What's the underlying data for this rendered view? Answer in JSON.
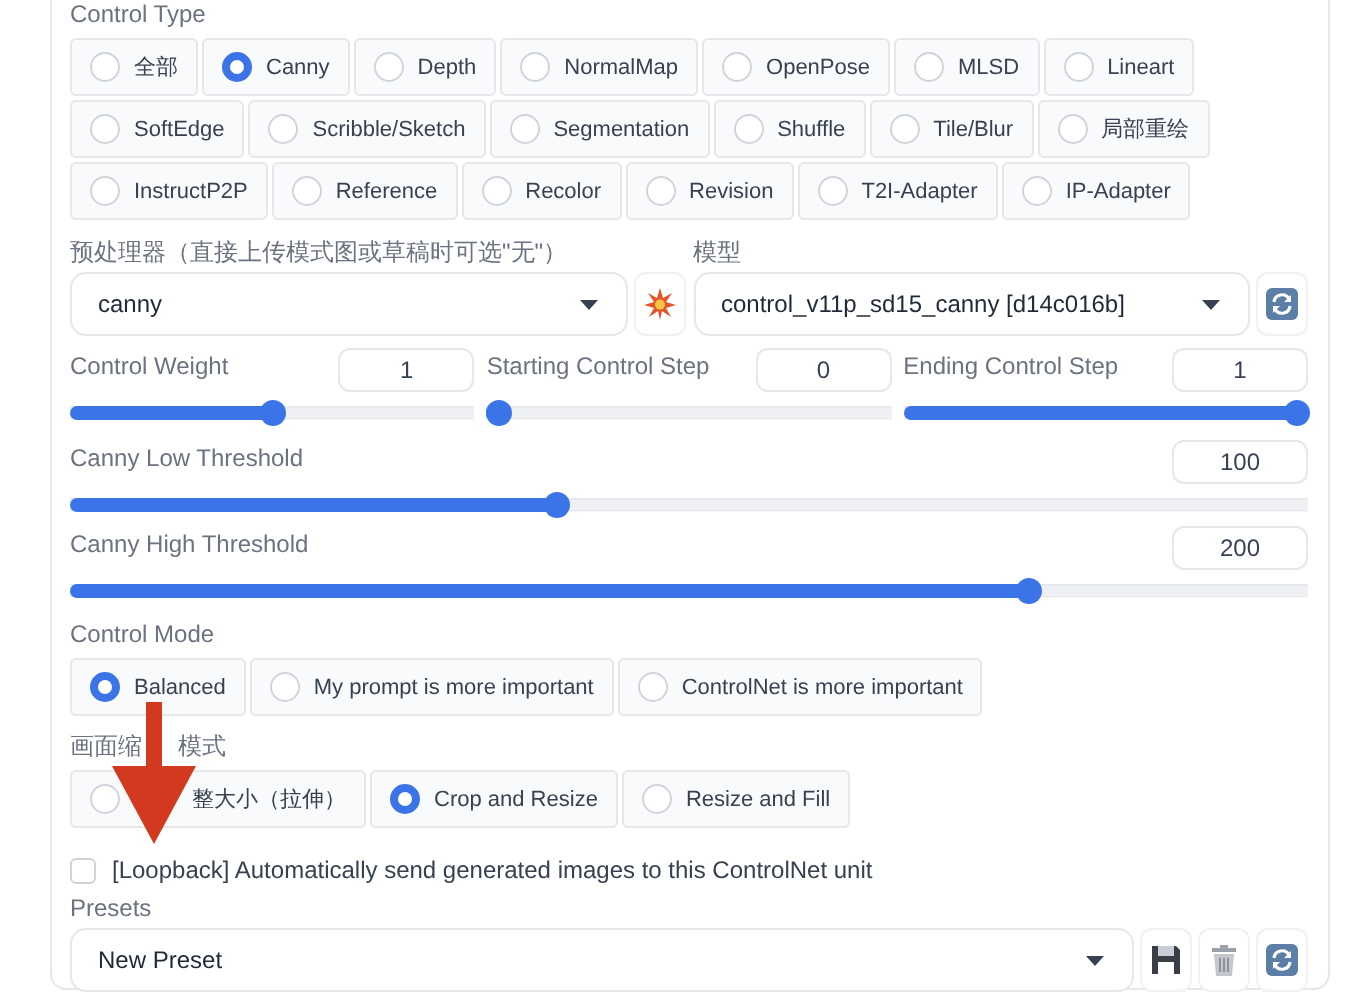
{
  "control_type": {
    "label": "Control Type",
    "rows": [
      {
        "options": [
          {
            "label": "全部",
            "selected": false
          },
          {
            "label": "Canny",
            "selected": true
          },
          {
            "label": "Depth",
            "selected": false
          },
          {
            "label": "NormalMap",
            "selected": false
          },
          {
            "label": "OpenPose",
            "selected": false
          },
          {
            "label": "MLSD",
            "selected": false
          },
          {
            "label": "Lineart",
            "selected": false
          }
        ]
      },
      {
        "options": [
          {
            "label": "SoftEdge",
            "selected": false
          },
          {
            "label": "Scribble/Sketch",
            "selected": false
          },
          {
            "label": "Segmentation",
            "selected": false
          },
          {
            "label": "Shuffle",
            "selected": false
          },
          {
            "label": "Tile/Blur",
            "selected": false
          },
          {
            "label": "局部重绘",
            "selected": false
          }
        ]
      },
      {
        "options": [
          {
            "label": "InstructP2P",
            "selected": false
          },
          {
            "label": "Reference",
            "selected": false
          },
          {
            "label": "Recolor",
            "selected": false
          },
          {
            "label": "Revision",
            "selected": false
          },
          {
            "label": "T2I-Adapter",
            "selected": false
          },
          {
            "label": "IP-Adapter",
            "selected": false
          }
        ]
      }
    ]
  },
  "preprocessor": {
    "label": "预处理器（直接上传模式图或草稿时可选\"无\"）",
    "value": "canny"
  },
  "model": {
    "label": "模型",
    "value": "control_v11p_sd15_canny [d14c016b]"
  },
  "steps": [
    {
      "label": "Control Weight",
      "value": "1",
      "level": 0.5
    },
    {
      "label": "Starting Control Step",
      "value": "0",
      "level": 0
    },
    {
      "label": "Ending Control Step",
      "value": "1",
      "level": 1
    }
  ],
  "thresholds": [
    {
      "label": "Canny Low Threshold",
      "value": "100",
      "level": 0.39
    },
    {
      "label": "Canny High Threshold",
      "value": "200",
      "level": 0.78
    }
  ],
  "control_mode": {
    "label": "Control Mode",
    "rows": [
      {
        "options": [
          {
            "label": "Balanced",
            "selected": true
          },
          {
            "label": "My prompt is more important",
            "selected": false
          },
          {
            "label": "ControlNet is more important",
            "selected": false
          }
        ]
      }
    ]
  },
  "resize_mode": {
    "label_parts": [
      "画面缩",
      "模式"
    ],
    "rows": [
      {
        "options": [
          {
            "label": "整大小（拉伸）",
            "selected": false
          },
          {
            "label": "Crop and Resize",
            "selected": true
          },
          {
            "label": "Resize and Fill",
            "selected": false
          }
        ]
      }
    ]
  },
  "loopback": {
    "label": "[Loopback] Automatically send generated images to this ControlNet unit",
    "checked": false
  },
  "presets": {
    "label": "Presets",
    "value": "New Preset"
  }
}
